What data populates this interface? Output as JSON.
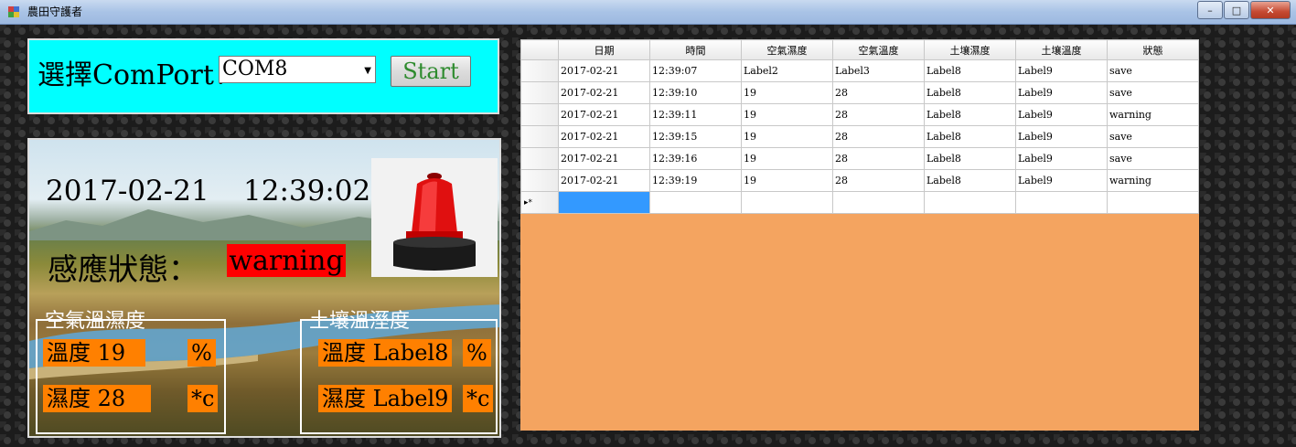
{
  "window": {
    "title": "農田守護者",
    "controls": [
      "–",
      "□",
      "✕"
    ]
  },
  "com_panel": {
    "label": "選擇ComPort：",
    "selected_port": "COM8",
    "start_button": "Start"
  },
  "status_panel": {
    "date": "2017-02-21",
    "time": "12:39:02",
    "sensor_label": "感應狀態：",
    "status_value": "warning",
    "air_group": {
      "title": "空氣溫濕度",
      "temp_label": "溫度 19",
      "temp_unit": "%",
      "humid_label": "濕度 28",
      "humid_unit": "*c"
    },
    "soil_group": {
      "title": "土壤溫溼度",
      "temp_label": "溫度 Label8",
      "temp_unit": "%",
      "humid_label": "濕度 Label9",
      "humid_unit": "*c"
    }
  },
  "grid": {
    "columns": [
      "日期",
      "時間",
      "空氣濕度",
      "空氣溫度",
      "土壤濕度",
      "土壤溫度",
      "狀態"
    ],
    "rows": [
      [
        "2017-02-21",
        "12:39:07",
        "Label2",
        "Label3",
        "Label8",
        "Label9",
        "save"
      ],
      [
        "2017-02-21",
        "12:39:10",
        "19",
        "28",
        "Label8",
        "Label9",
        "save"
      ],
      [
        "2017-02-21",
        "12:39:11",
        "19",
        "28",
        "Label8",
        "Label9",
        "warning"
      ],
      [
        "2017-02-21",
        "12:39:15",
        "19",
        "28",
        "Label8",
        "Label9",
        "save"
      ],
      [
        "2017-02-21",
        "12:39:16",
        "19",
        "28",
        "Label8",
        "Label9",
        "save"
      ],
      [
        "2017-02-21",
        "12:39:19",
        "19",
        "28",
        "Label8",
        "Label9",
        "warning"
      ]
    ],
    "new_row_marker": "▸*"
  },
  "colors": {
    "com_panel_bg": "#00ffff",
    "warning_bg": "#ff0000",
    "value_bg": "#ff8000",
    "grid_bg": "#f4a460",
    "selected_cell": "#3399ff"
  }
}
